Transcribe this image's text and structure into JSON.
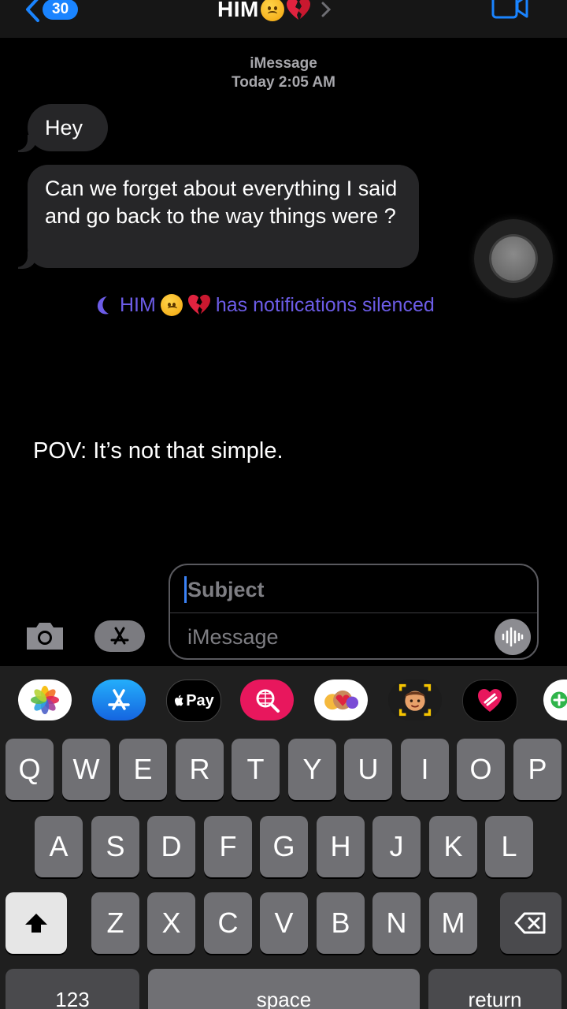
{
  "header": {
    "back_count": "30",
    "contact_name": "HIM"
  },
  "thread": {
    "service": "iMessage",
    "timestamp": "Today 2:05 AM",
    "messages": [
      {
        "text": "Hey"
      },
      {
        "text": "Can we forget about everything I said and go back to the way things were ?"
      }
    ],
    "silenced_name": "HIM",
    "silenced_text": "has notifications silenced"
  },
  "overlay_caption": "POV: It’s not that simple.",
  "composer": {
    "subject_placeholder": "Subject",
    "message_placeholder": "iMessage"
  },
  "app_strip": {
    "apple_pay_label": "Pay",
    "items": [
      "photos-app-icon",
      "app-store-icon",
      "apple-pay-icon",
      "web-search-icon",
      "memoji-stickers-icon",
      "memoji-icon",
      "heart-sticker-icon",
      "game-app-icon"
    ]
  },
  "keyboard": {
    "row1": [
      "Q",
      "W",
      "E",
      "R",
      "T",
      "Y",
      "U",
      "I",
      "O",
      "P"
    ],
    "row2": [
      "A",
      "S",
      "D",
      "F",
      "G",
      "H",
      "J",
      "K",
      "L"
    ],
    "row3": [
      "Z",
      "X",
      "C",
      "V",
      "B",
      "N",
      "M"
    ],
    "numbers_label": "123",
    "space_label": "space",
    "return_label": "return"
  },
  "colors": {
    "accent_blue": "#1a84ff",
    "silenced_purple": "#6c5ce7",
    "bubble_gray": "#262628"
  }
}
